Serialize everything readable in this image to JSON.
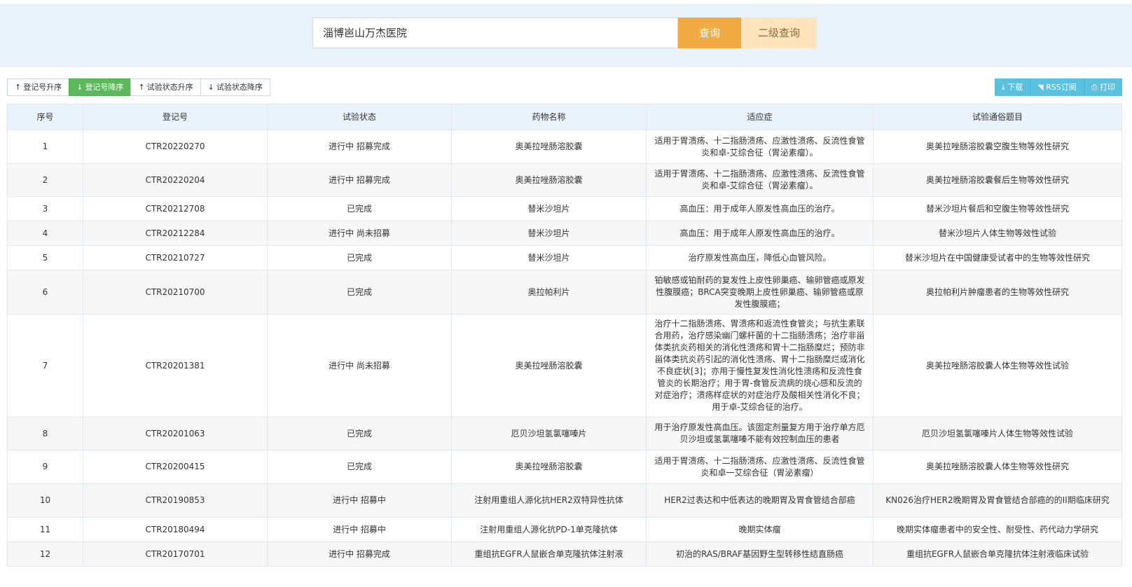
{
  "search": {
    "value": "淄博岜山万杰医院",
    "query_label": "查询",
    "secondary_query_label": "二级查询"
  },
  "sort_buttons": [
    {
      "arrow": "↑",
      "label": "登记号升序",
      "active": false
    },
    {
      "arrow": "↓",
      "label": "登记号降序",
      "active": true
    },
    {
      "arrow": "↑",
      "label": "试验状态升序",
      "active": false
    },
    {
      "arrow": "↓",
      "label": "试验状态降序",
      "active": false
    }
  ],
  "tools": [
    {
      "icon": "⤓",
      "label": "下载"
    },
    {
      "icon": "◥",
      "label": "RSS订阅"
    },
    {
      "icon": "⎙",
      "label": "打印"
    }
  ],
  "table": {
    "headers": [
      "序号",
      "登记号",
      "试验状态",
      "药物名称",
      "适应症",
      "试验通俗题目"
    ],
    "rows": [
      {
        "no": "1",
        "reg": "CTR20220270",
        "status": "进行中 招募完成",
        "drug": "奥美拉唑肠溶胶囊",
        "ind": "适用于胃溃疡、十二指肠溃疡、应激性溃疡、反流性食管炎和卓-艾综合征（胃泌素瘤）。",
        "title": "奥美拉唑肠溶胶囊空腹生物等效性研究"
      },
      {
        "no": "2",
        "reg": "CTR20220204",
        "status": "进行中 招募完成",
        "drug": "奥美拉唑肠溶胶囊",
        "ind": "适用于胃溃疡、十二指肠溃疡、应激性溃疡、反流性食管炎和卓-艾综合征（胃泌素瘤）。",
        "title": "奥美拉唑肠溶胶囊餐后生物等效性研究"
      },
      {
        "no": "3",
        "reg": "CTR20212708",
        "status": "已完成",
        "drug": "替米沙坦片",
        "ind": "高血压：用于成年人原发性高血压的治疗。",
        "title": "替米沙坦片餐后和空腹生物等效性研究"
      },
      {
        "no": "4",
        "reg": "CTR20212284",
        "status": "进行中 尚未招募",
        "drug": "替米沙坦片",
        "ind": "高血压：用于成年人原发性高血压的治疗。",
        "title": "替米沙坦片人体生物等效性试验"
      },
      {
        "no": "5",
        "reg": "CTR20210727",
        "status": "已完成",
        "drug": "替米沙坦片",
        "ind": "治疗原发性高血压，降低心血管风险。",
        "title": "替米沙坦片在中国健康受试者中的生物等效性研究"
      },
      {
        "no": "6",
        "reg": "CTR20210700",
        "status": "已完成",
        "drug": "奥拉帕利片",
        "ind": "铂敏感或铂耐药的复发性上皮性卵巢癌、输卵管癌或原发性腹膜癌；BRCA突变晚期上皮性卵巢癌、输卵管癌或原发性腹膜癌；",
        "title": "奥拉帕利片肿瘤患者的生物等效性研究"
      },
      {
        "no": "7",
        "reg": "CTR20201381",
        "status": "进行中 尚未招募",
        "drug": "奥美拉唑肠溶胶囊",
        "ind": "治疗十二指肠溃疡、胃溃疡和返流性食管炎；与抗生素联合用药，治疗感染幽门螺杆菌的十二指肠溃疡；治疗非甾体类抗炎药相关的消化性溃疡和胃十二指肠糜烂；预防非甾体类抗炎药引起的消化性溃疡、胃十二指肠糜烂或消化不良症状[3]；亦用于慢性复发性消化性溃疡和反流性食管炎的长期治疗；用于胃-食管反流病的烧心感和反流的对症治疗；溃疡样症状的对症治疗及酸相关性消化不良；用于卓-艾综合征的治疗。",
        "title": "奥美拉唑肠溶胶囊人体生物等效性试验"
      },
      {
        "no": "8",
        "reg": "CTR20201063",
        "status": "已完成",
        "drug": "厄贝沙坦氢氯噻嗪片",
        "ind": "用于治疗原发性高血压。该固定剂量复方用于治疗单方厄贝沙坦或氢氯噻嗪不能有效控制血压的患者",
        "title": "厄贝沙坦氢氯噻嗪片人体生物等效性试验"
      },
      {
        "no": "9",
        "reg": "CTR20200415",
        "status": "已完成",
        "drug": "奥美拉唑肠溶胶囊",
        "ind": "适用于胃溃疡、十二指肠溃疡、应激性溃疡、反流性食管炎和卓一艾综合征（胃泌素瘤）",
        "title": "奥美拉唑肠溶胶囊人体生物等效性研究"
      },
      {
        "no": "10",
        "reg": "CTR20190853",
        "status": "进行中 招募中",
        "drug": "注射用重组人源化抗HER2双特异性抗体",
        "ind": "HER2过表达和中低表达的晚期胃及胃食管结合部癌",
        "title": "KN026治疗HER2晚期胃及胃食管结合部癌的的II期临床研究"
      },
      {
        "no": "11",
        "reg": "CTR20180494",
        "status": "进行中 招募中",
        "drug": "注射用重组人源化抗PD-1单克隆抗体",
        "ind": "晚期实体瘤",
        "title": "晚期实体瘤患者中的安全性、耐受性、药代动力学研究"
      },
      {
        "no": "12",
        "reg": "CTR20170701",
        "status": "进行中 招募完成",
        "drug": "重组抗EGFR人鼠嵌合单克隆抗体注射液",
        "ind": "初治的RAS/BRAF基因野生型转移性结直肠癌",
        "title": "重组抗EGFR人鼠嵌合单克隆抗体注射液临床试验"
      }
    ]
  }
}
